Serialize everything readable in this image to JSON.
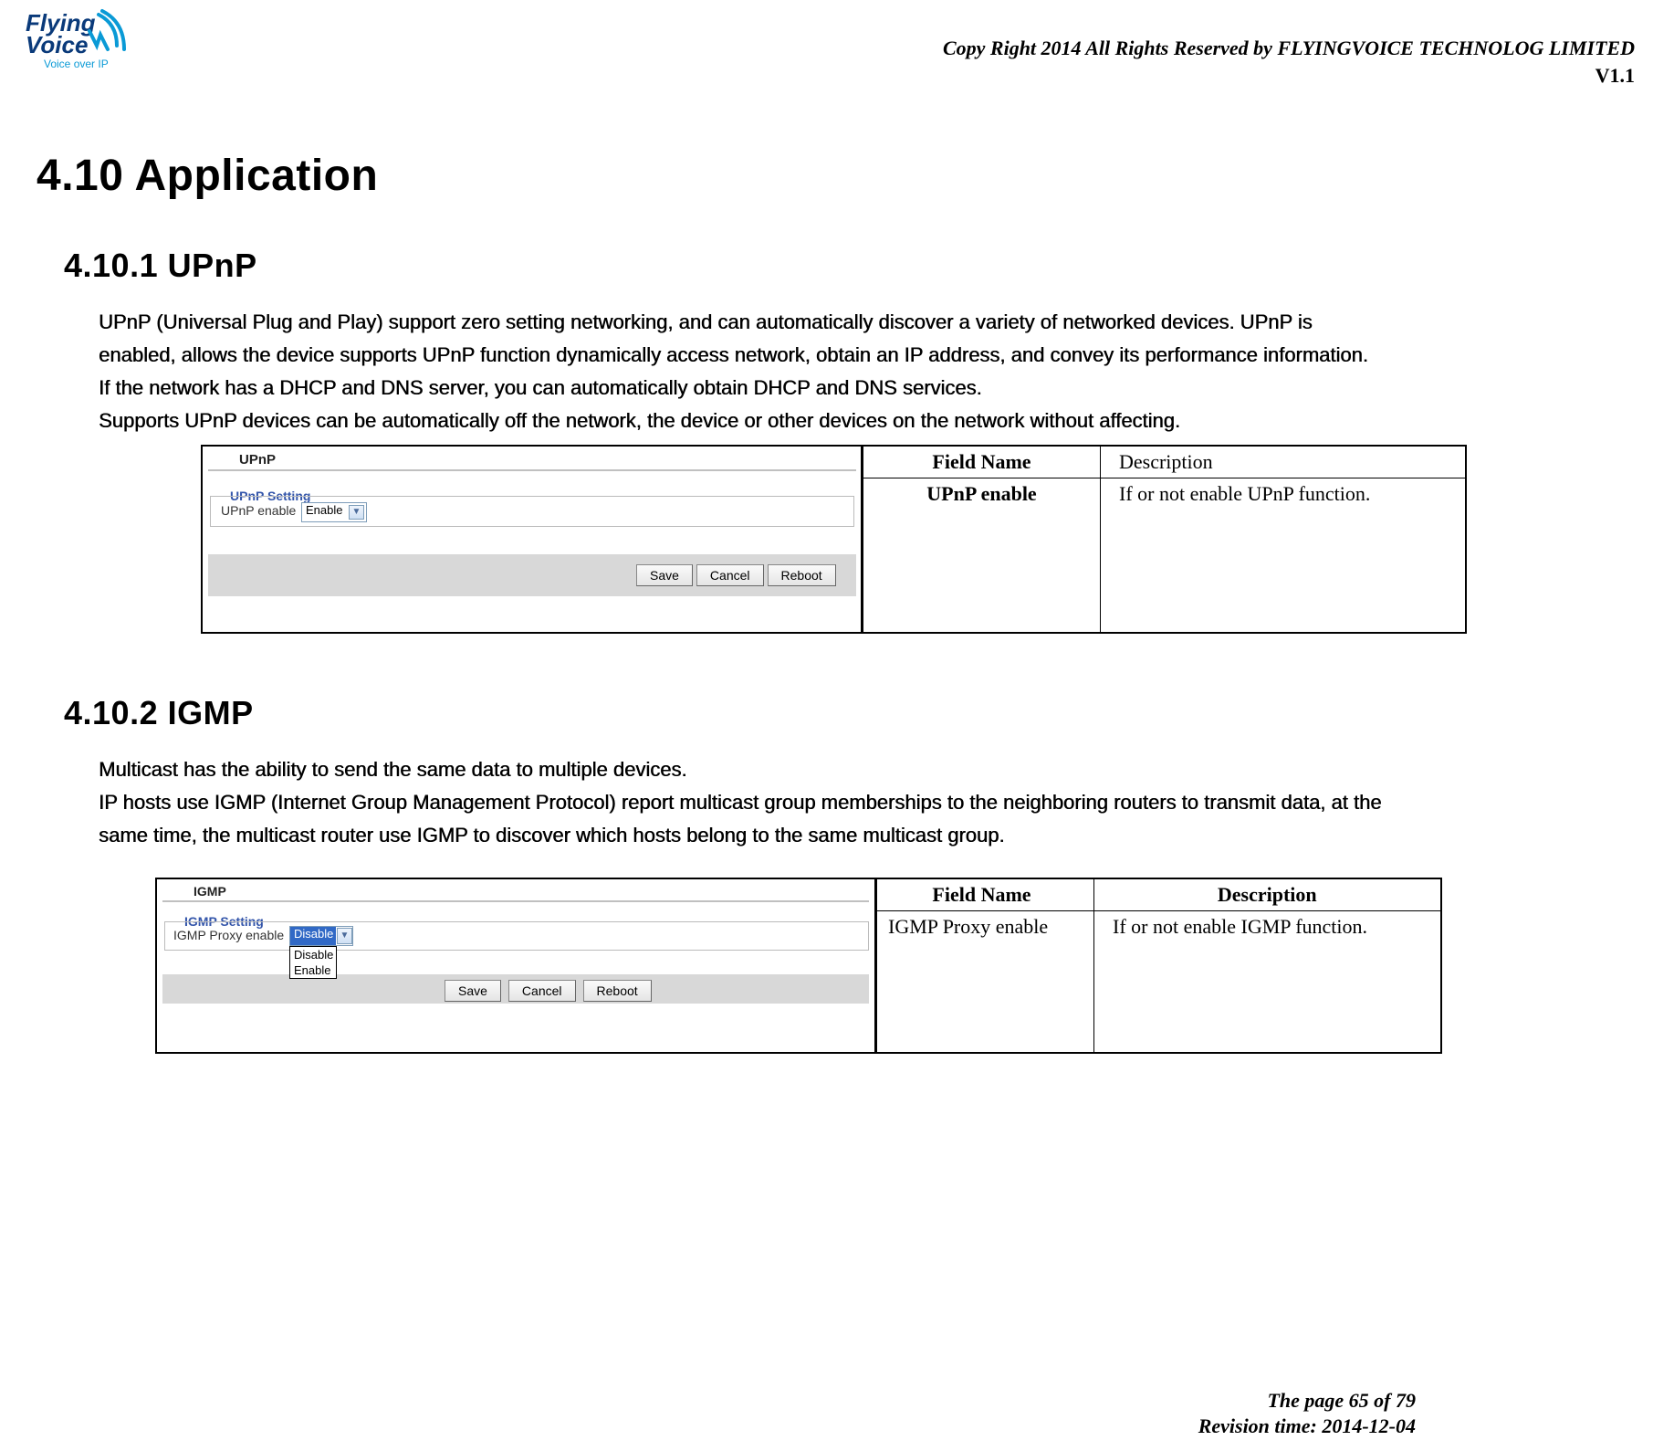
{
  "logo": {
    "line1": "Flying",
    "line2": "Voice",
    "tagline": "Voice over IP"
  },
  "header": {
    "copyright": "Copy Right 2014 All Rights Reserved by FLYINGVOICE TECHNOLOG LIMITED",
    "version": "V1.1"
  },
  "h1": "4.10  Application",
  "upnp": {
    "heading": "4.10.1  UPnP",
    "para1": "UPnP (Universal Plug and Play) support zero setting networking, and can automatically discover a variety of networked devices. UPnP is",
    "para2": "enabled, allows the device supports UPnP function dynamically access network, obtain an IP address, and convey its performance information.",
    "para3": "If the network has a DHCP and DNS server, you can automatically obtain DHCP and DNS services.",
    "para4": "Supports UPnP devices can be automatically off the network, the device or other devices on the network without affecting.",
    "shot": {
      "panel_title": "UPnP",
      "setting_title": "UPnP Setting",
      "label": "UPnP enable",
      "select_value": "Enable",
      "btn_save": "Save",
      "btn_cancel": "Cancel",
      "btn_reboot": "Reboot"
    },
    "table": {
      "th1": "Field Name",
      "th2": "Description",
      "r1c1": "UPnP enable",
      "r1c2": "If or not enable UPnP function."
    }
  },
  "igmp": {
    "heading": "4.10.2   IGMP",
    "para1": "Multicast has the ability to send the same data to multiple devices.",
    "para2": "IP hosts use IGMP (Internet Group Management Protocol) report multicast group memberships to the neighboring routers to transmit data, at the",
    "para3": "same time, the multicast router use IGMP to discover which hosts belong to the same multicast group.",
    "shot": {
      "panel_title": "IGMP",
      "setting_title": "IGMP Setting",
      "label": "IGMP Proxy enable",
      "select_value": "Disable",
      "option1": "Disable",
      "option2": "Enable",
      "btn_save": "Save",
      "btn_cancel": "Cancel",
      "btn_reboot": "Reboot"
    },
    "table": {
      "th1": "Field Name",
      "th2": "Description",
      "r1c1": "IGMP Proxy enable",
      "r1c2": "If or not enable IGMP function."
    }
  },
  "footer": {
    "page": "The page 65 of 79",
    "revision": "Revision time: 2014-12-04"
  }
}
